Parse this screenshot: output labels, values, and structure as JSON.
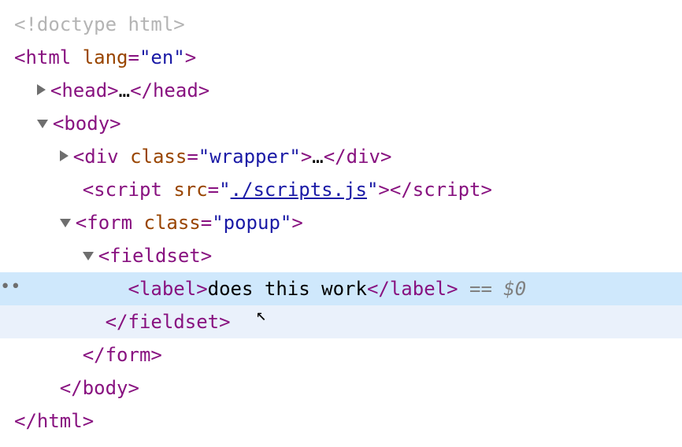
{
  "lines": {
    "doctype_open": "<",
    "doctype_text": "!doctype html",
    "doctype_close": ">",
    "html_open_tag": "html",
    "html_lang_attr": "lang",
    "html_lang_val": "\"en\"",
    "head_tag": "head",
    "ellipsis": "…",
    "body_tag": "body",
    "div_tag": "div",
    "class_attr": "class",
    "wrapper_val": "\"wrapper\"",
    "script_tag": "script",
    "src_attr": "src",
    "src_val": "./scripts.js",
    "form_tag": "form",
    "popup_val": "\"popup\"",
    "fieldset_tag": "fieldset",
    "label_tag": "label",
    "label_text": "does this work",
    "eq0": " == $0"
  }
}
